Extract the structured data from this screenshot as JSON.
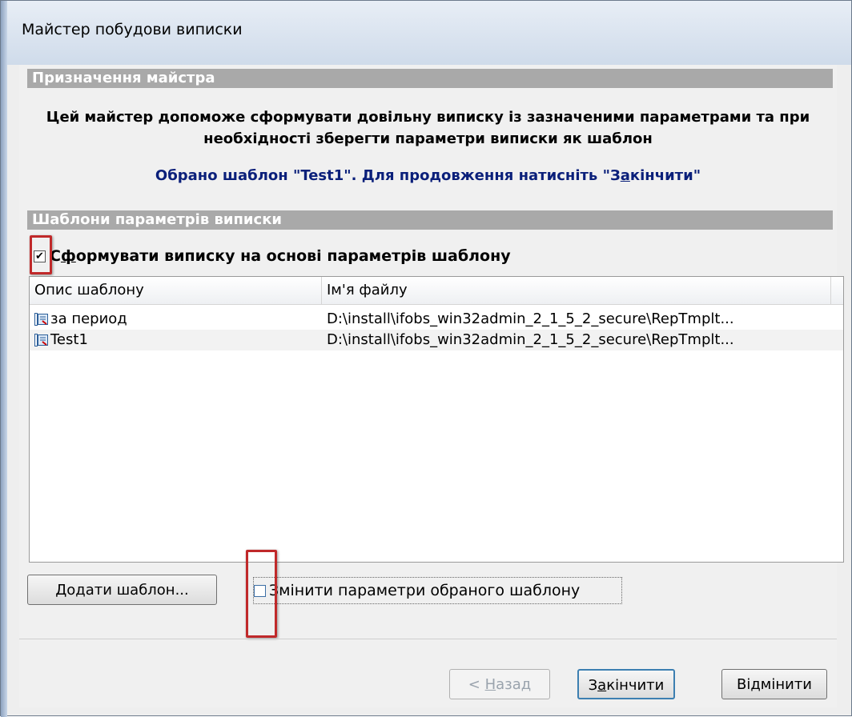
{
  "window": {
    "title": "Майстер побудови виписки"
  },
  "purpose": {
    "header": "Призначення майстра",
    "description": "Цей майстер допоможе сформувати довільну виписку із зазначеними параметрами та при необхідності зберегти параметри виписки як шаблон",
    "selected_before": "Обрано шаблон \"Test1\". Для продовження натисніть \"З",
    "selected_accel": "а",
    "selected_after": "кінчити\""
  },
  "templates": {
    "header": "Шаблони параметрів виписки",
    "use_template": {
      "checked": true,
      "label_pre": "С",
      "label_accel": "ф",
      "label_post": "ормувати виписку на основі параметрів шаблону"
    },
    "columns": [
      "Опис шаблону",
      "Ім'я файлу"
    ],
    "rows": [
      {
        "description": "за период",
        "file": "D:\\install\\ifobs_win32admin_2_1_5_2_secure\\RepTmplt...",
        "icon": "template-icon"
      },
      {
        "description": "Test1",
        "file": "D:\\install\\ifobs_win32admin_2_1_5_2_secure\\RepTmplt...",
        "icon": "template-icon"
      }
    ],
    "add_button": "Додати шаблон...",
    "change_params": {
      "checked": false,
      "label": "Змінити параметри обраного шаблону"
    }
  },
  "footer": {
    "back": {
      "pre": "< ",
      "accel": "Н",
      "post": "азад"
    },
    "finish": {
      "pre": "З",
      "accel": "а",
      "post": "кінчити"
    },
    "cancel": "Відмінити"
  },
  "colors": {
    "highlight": "#c0292a",
    "section_bar": "#a9a9a9",
    "info_text": "#0a1f7a"
  }
}
